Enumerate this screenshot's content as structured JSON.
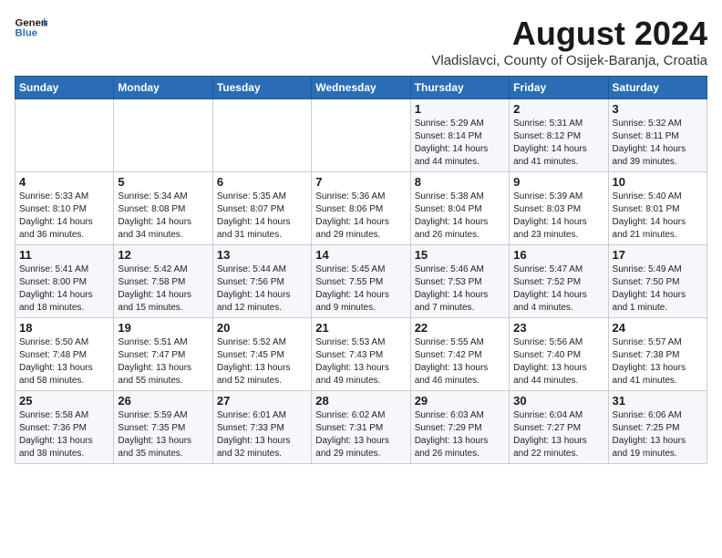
{
  "header": {
    "logo_line1": "General",
    "logo_line2": "Blue",
    "month_year": "August 2024",
    "location": "Vladislavci, County of Osijek-Baranja, Croatia"
  },
  "weekdays": [
    "Sunday",
    "Monday",
    "Tuesday",
    "Wednesday",
    "Thursday",
    "Friday",
    "Saturday"
  ],
  "weeks": [
    [
      {
        "day": "",
        "detail": ""
      },
      {
        "day": "",
        "detail": ""
      },
      {
        "day": "",
        "detail": ""
      },
      {
        "day": "",
        "detail": ""
      },
      {
        "day": "1",
        "detail": "Sunrise: 5:29 AM\nSunset: 8:14 PM\nDaylight: 14 hours\nand 44 minutes."
      },
      {
        "day": "2",
        "detail": "Sunrise: 5:31 AM\nSunset: 8:12 PM\nDaylight: 14 hours\nand 41 minutes."
      },
      {
        "day": "3",
        "detail": "Sunrise: 5:32 AM\nSunset: 8:11 PM\nDaylight: 14 hours\nand 39 minutes."
      }
    ],
    [
      {
        "day": "4",
        "detail": "Sunrise: 5:33 AM\nSunset: 8:10 PM\nDaylight: 14 hours\nand 36 minutes."
      },
      {
        "day": "5",
        "detail": "Sunrise: 5:34 AM\nSunset: 8:08 PM\nDaylight: 14 hours\nand 34 minutes."
      },
      {
        "day": "6",
        "detail": "Sunrise: 5:35 AM\nSunset: 8:07 PM\nDaylight: 14 hours\nand 31 minutes."
      },
      {
        "day": "7",
        "detail": "Sunrise: 5:36 AM\nSunset: 8:06 PM\nDaylight: 14 hours\nand 29 minutes."
      },
      {
        "day": "8",
        "detail": "Sunrise: 5:38 AM\nSunset: 8:04 PM\nDaylight: 14 hours\nand 26 minutes."
      },
      {
        "day": "9",
        "detail": "Sunrise: 5:39 AM\nSunset: 8:03 PM\nDaylight: 14 hours\nand 23 minutes."
      },
      {
        "day": "10",
        "detail": "Sunrise: 5:40 AM\nSunset: 8:01 PM\nDaylight: 14 hours\nand 21 minutes."
      }
    ],
    [
      {
        "day": "11",
        "detail": "Sunrise: 5:41 AM\nSunset: 8:00 PM\nDaylight: 14 hours\nand 18 minutes."
      },
      {
        "day": "12",
        "detail": "Sunrise: 5:42 AM\nSunset: 7:58 PM\nDaylight: 14 hours\nand 15 minutes."
      },
      {
        "day": "13",
        "detail": "Sunrise: 5:44 AM\nSunset: 7:56 PM\nDaylight: 14 hours\nand 12 minutes."
      },
      {
        "day": "14",
        "detail": "Sunrise: 5:45 AM\nSunset: 7:55 PM\nDaylight: 14 hours\nand 9 minutes."
      },
      {
        "day": "15",
        "detail": "Sunrise: 5:46 AM\nSunset: 7:53 PM\nDaylight: 14 hours\nand 7 minutes."
      },
      {
        "day": "16",
        "detail": "Sunrise: 5:47 AM\nSunset: 7:52 PM\nDaylight: 14 hours\nand 4 minutes."
      },
      {
        "day": "17",
        "detail": "Sunrise: 5:49 AM\nSunset: 7:50 PM\nDaylight: 14 hours\nand 1 minute."
      }
    ],
    [
      {
        "day": "18",
        "detail": "Sunrise: 5:50 AM\nSunset: 7:48 PM\nDaylight: 13 hours\nand 58 minutes."
      },
      {
        "day": "19",
        "detail": "Sunrise: 5:51 AM\nSunset: 7:47 PM\nDaylight: 13 hours\nand 55 minutes."
      },
      {
        "day": "20",
        "detail": "Sunrise: 5:52 AM\nSunset: 7:45 PM\nDaylight: 13 hours\nand 52 minutes."
      },
      {
        "day": "21",
        "detail": "Sunrise: 5:53 AM\nSunset: 7:43 PM\nDaylight: 13 hours\nand 49 minutes."
      },
      {
        "day": "22",
        "detail": "Sunrise: 5:55 AM\nSunset: 7:42 PM\nDaylight: 13 hours\nand 46 minutes."
      },
      {
        "day": "23",
        "detail": "Sunrise: 5:56 AM\nSunset: 7:40 PM\nDaylight: 13 hours\nand 44 minutes."
      },
      {
        "day": "24",
        "detail": "Sunrise: 5:57 AM\nSunset: 7:38 PM\nDaylight: 13 hours\nand 41 minutes."
      }
    ],
    [
      {
        "day": "25",
        "detail": "Sunrise: 5:58 AM\nSunset: 7:36 PM\nDaylight: 13 hours\nand 38 minutes."
      },
      {
        "day": "26",
        "detail": "Sunrise: 5:59 AM\nSunset: 7:35 PM\nDaylight: 13 hours\nand 35 minutes."
      },
      {
        "day": "27",
        "detail": "Sunrise: 6:01 AM\nSunset: 7:33 PM\nDaylight: 13 hours\nand 32 minutes."
      },
      {
        "day": "28",
        "detail": "Sunrise: 6:02 AM\nSunset: 7:31 PM\nDaylight: 13 hours\nand 29 minutes."
      },
      {
        "day": "29",
        "detail": "Sunrise: 6:03 AM\nSunset: 7:29 PM\nDaylight: 13 hours\nand 26 minutes."
      },
      {
        "day": "30",
        "detail": "Sunrise: 6:04 AM\nSunset: 7:27 PM\nDaylight: 13 hours\nand 22 minutes."
      },
      {
        "day": "31",
        "detail": "Sunrise: 6:06 AM\nSunset: 7:25 PM\nDaylight: 13 hours\nand 19 minutes."
      }
    ]
  ]
}
